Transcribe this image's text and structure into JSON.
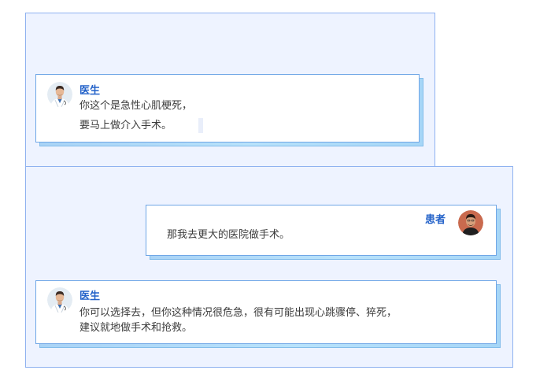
{
  "colors": {
    "panel_bg": "#eef3ff",
    "panel_border": "#8fb2f0",
    "bubble_border": "#6fa6e6",
    "shadow": "#a9d3f6",
    "speaker": "#2362c9",
    "text": "#3c3c3c"
  },
  "messages": [
    {
      "speaker": "医生",
      "avatar_icon": "doctor-avatar-icon",
      "lines": [
        "你这个是急性心肌梗死，",
        "要马上做介入手术。"
      ]
    },
    {
      "speaker": "患者",
      "avatar_icon": "patient-avatar-icon",
      "lines": [
        "那我去更大的医院做手术。"
      ]
    },
    {
      "speaker": "医生",
      "avatar_icon": "doctor-avatar-icon",
      "lines": [
        "你可以选择去，但你这种情况很危急，很有可能出现心跳骤停、猝死，",
        "建议就地做手术和抢救。"
      ]
    }
  ]
}
